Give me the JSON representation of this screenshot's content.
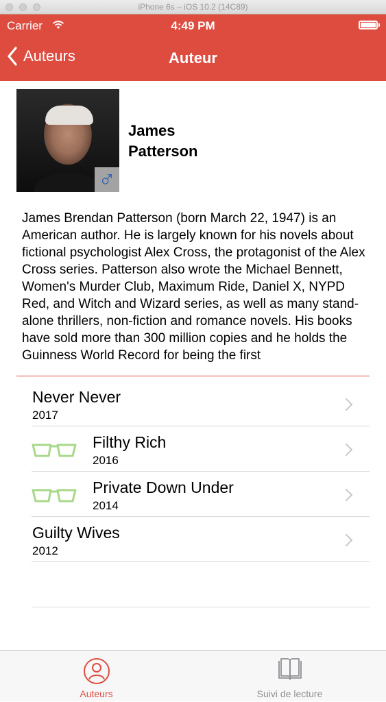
{
  "window": {
    "title": "iPhone 6s – iOS 10.2 (14C89)"
  },
  "status_bar": {
    "carrier": "Carrier",
    "time": "4:49 PM"
  },
  "nav": {
    "back_label": "Auteurs",
    "title": "Auteur"
  },
  "author": {
    "name": "James Patterson",
    "gender_symbol": "♂",
    "bio": "James Brendan Patterson (born March 22, 1947) is an American author. He is largely known for his novels about fictional psychologist Alex Cross, the protagonist of the Alex Cross series. Patterson also wrote the Michael Bennett, Women's Murder Club, Maximum Ride, Daniel X, NYPD Red, and Witch and Wizard series, as well as many stand-alone thrillers, non-fiction and romance novels. His books have sold more than 300 million copies and he holds the Guinness World Record for being the first"
  },
  "books": [
    {
      "title": "Never Never",
      "year": "2017",
      "read": false
    },
    {
      "title": "Filthy Rich",
      "year": "2016",
      "read": true
    },
    {
      "title": "Private Down Under",
      "year": "2014",
      "read": true
    },
    {
      "title": "Guilty Wives",
      "year": "2012",
      "read": false
    }
  ],
  "tabs": [
    {
      "label": "Auteurs",
      "icon": "person-icon",
      "active": true
    },
    {
      "label": "Suivi de lecture",
      "icon": "book-icon",
      "active": false
    }
  ],
  "colors": {
    "accent": "#de4c40",
    "read_indicator": "#a8d88a",
    "chevron": "#c7c7cc",
    "tab_inactive": "#8e8e93",
    "gender_badge": "#2c5fb3"
  }
}
